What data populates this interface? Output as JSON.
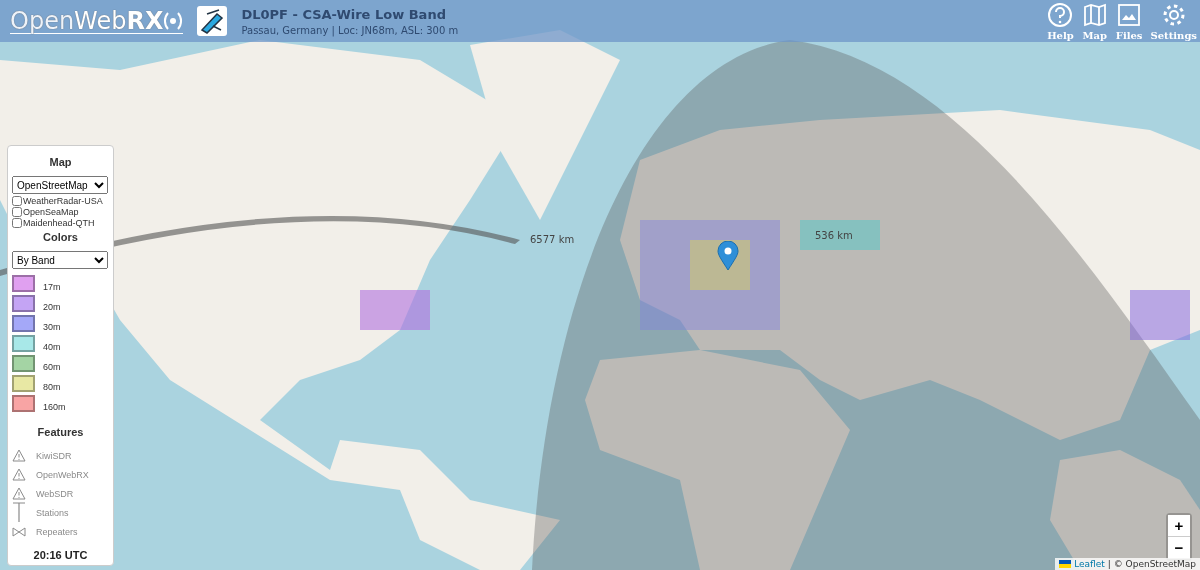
{
  "header": {
    "logo": {
      "light": "Open",
      "mid": "Web",
      "bold": "RX"
    },
    "receiver": {
      "title": "DL0PF - CSA-Wire Low Band",
      "subtitle": "Passau, Germany | Loc: JN68m, ASL: 300 m"
    },
    "buttons": [
      {
        "label": "Help",
        "kind": "help"
      },
      {
        "label": "Map",
        "kind": "map"
      },
      {
        "label": "Files",
        "kind": "files"
      },
      {
        "label": "Settings",
        "kind": "settings"
      }
    ]
  },
  "map": {
    "kind": "picture",
    "distance_labels": [
      {
        "text": "6577 km"
      },
      {
        "text": "536 km"
      }
    ]
  },
  "panel": {
    "map_heading": "Map",
    "map_layer": "OpenStreetMap",
    "overlays": [
      {
        "label": "WeatherRadar-USA",
        "checked": false
      },
      {
        "label": "OpenSeaMap",
        "checked": false
      },
      {
        "label": "Maidenhead-QTH",
        "checked": false
      }
    ],
    "colors_heading": "Colors",
    "color_mode": "By Band",
    "legend": [
      {
        "label": "17m",
        "color": "#e0a0f0"
      },
      {
        "label": "20m",
        "color": "#c4a4f4"
      },
      {
        "label": "30m",
        "color": "#a4a8f8"
      },
      {
        "label": "40m",
        "color": "#a8e8e8"
      },
      {
        "label": "60m",
        "color": "#a4d4a4"
      },
      {
        "label": "80m",
        "color": "#e8e8a4"
      },
      {
        "label": "160m",
        "color": "#f8a4a4"
      }
    ],
    "features_heading": "Features",
    "features": [
      {
        "label": "KiwiSDR",
        "kind": "triangle",
        "disabled": true
      },
      {
        "label": "OpenWebRX",
        "kind": "triangle",
        "disabled": true
      },
      {
        "label": "WebSDR",
        "kind": "triangle",
        "disabled": true
      },
      {
        "label": "Stations",
        "kind": "mast",
        "disabled": true
      },
      {
        "label": "Repeaters",
        "kind": "bowtie",
        "disabled": true
      }
    ],
    "clock": "20:16 UTC"
  },
  "zoom": {
    "in": "+",
    "out": "−"
  },
  "attribution": {
    "link": "Leaflet",
    "text": "| © OpenStreetMap"
  }
}
